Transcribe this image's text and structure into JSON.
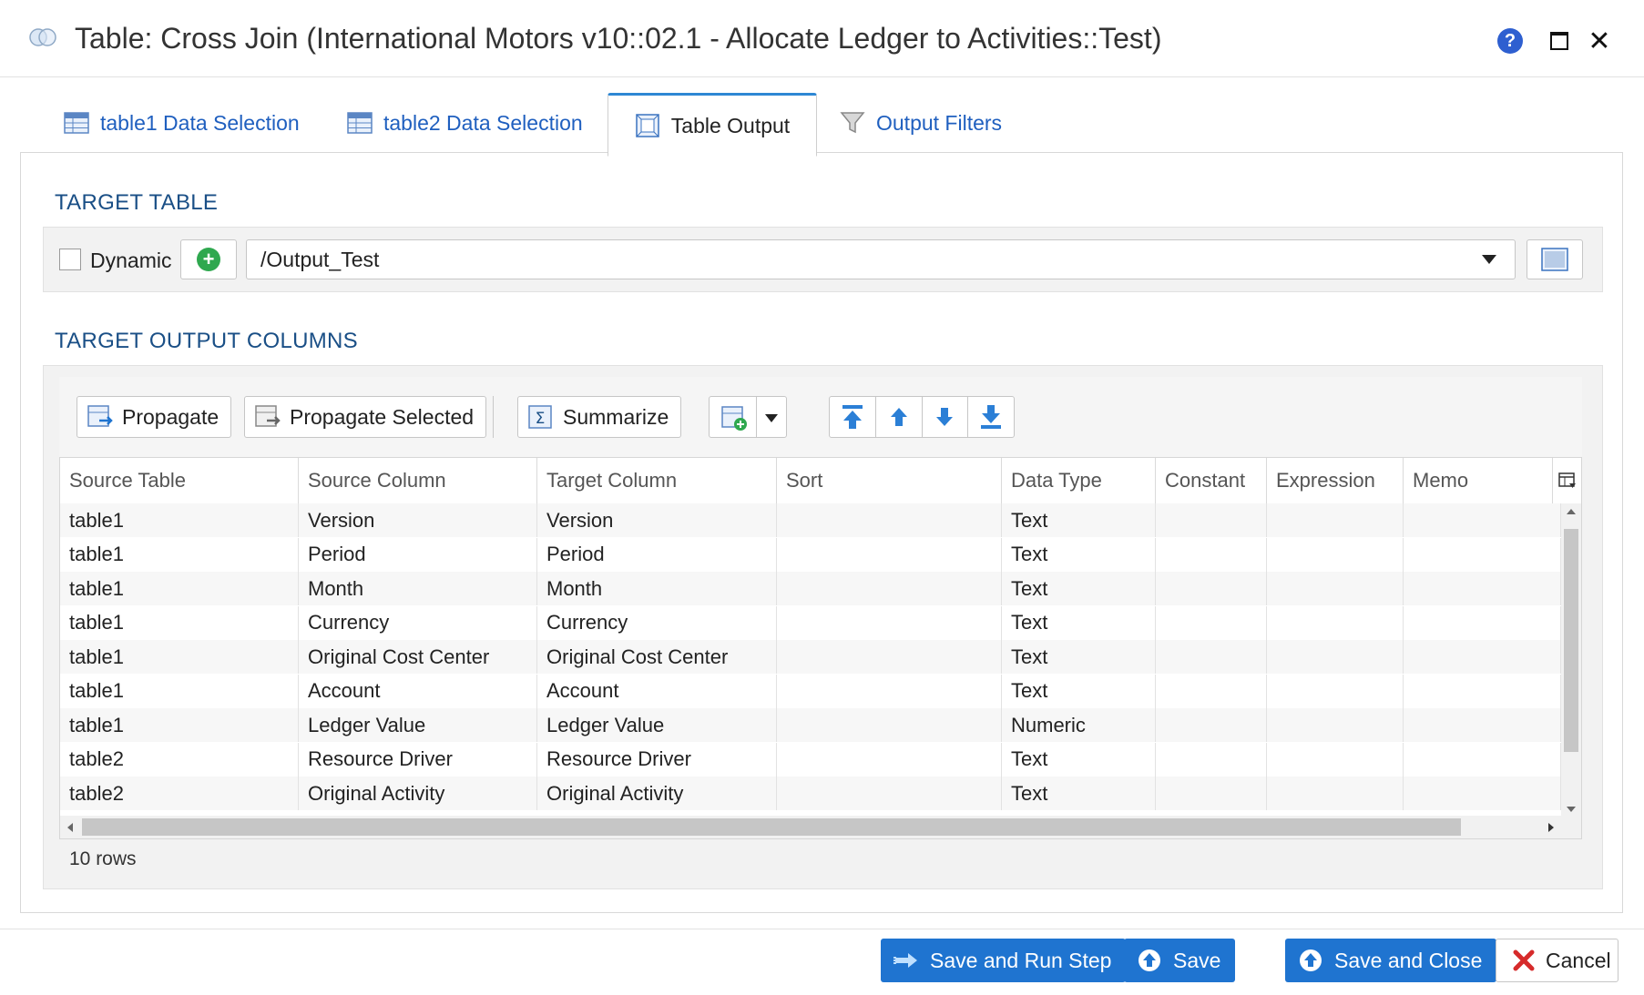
{
  "window": {
    "title": "Table: Cross Join (International Motors v10::02.1 - Allocate Ledger to Activities::Test)",
    "icons": {
      "app": "venn-icon",
      "help": "help-icon",
      "maximize": "maximize-icon",
      "close": "close-icon"
    },
    "help_glyph": "?",
    "close_glyph": "✕"
  },
  "tabs": [
    {
      "label": "table1 Data Selection",
      "icon": "table-icon",
      "active": false
    },
    {
      "label": "table2 Data Selection",
      "icon": "table-icon",
      "active": false
    },
    {
      "label": "Table Output",
      "icon": "table-output-icon",
      "active": true
    },
    {
      "label": "Output Filters",
      "icon": "filter-icon",
      "active": false
    }
  ],
  "target_table": {
    "section_title": "TARGET TABLE",
    "dynamic_label": "Dynamic",
    "dynamic_checked": false,
    "add_glyph": "+",
    "selected_table": "/Output_Test"
  },
  "output_columns": {
    "section_title": "TARGET OUTPUT COLUMNS",
    "toolbar": {
      "propagate": "Propagate",
      "propagate_selected": "Propagate Selected",
      "summarize": "Summarize"
    },
    "headers": [
      "Source Table",
      "Source Column",
      "Target Column",
      "Sort",
      "Data Type",
      "Constant",
      "Expression",
      "Memo"
    ],
    "rows": [
      [
        "table1",
        "Version",
        "Version",
        "",
        "Text",
        "",
        "",
        ""
      ],
      [
        "table1",
        "Period",
        "Period",
        "",
        "Text",
        "",
        "",
        ""
      ],
      [
        "table1",
        "Month",
        "Month",
        "",
        "Text",
        "",
        "",
        ""
      ],
      [
        "table1",
        "Currency",
        "Currency",
        "",
        "Text",
        "",
        "",
        ""
      ],
      [
        "table1",
        "Original Cost Center",
        "Original Cost Center",
        "",
        "Text",
        "",
        "",
        ""
      ],
      [
        "table1",
        "Account",
        "Account",
        "",
        "Text",
        "",
        "",
        ""
      ],
      [
        "table1",
        "Ledger Value",
        "Ledger Value",
        "",
        "Numeric",
        "",
        "",
        ""
      ],
      [
        "table2",
        "Resource Driver",
        "Resource Driver",
        "",
        "Text",
        "",
        "",
        ""
      ],
      [
        "table2",
        "Original Activity",
        "Original Activity",
        "",
        "Text",
        "",
        "",
        ""
      ]
    ],
    "row_count": "10 rows"
  },
  "footer": {
    "save_and_run": "Save and Run Step",
    "save": "Save",
    "save_and_close": "Save and Close",
    "cancel": "Cancel"
  },
  "colors": {
    "accent": "#1f74d0",
    "link": "#1f5fbf",
    "section_title": "#1a4f86",
    "add_green": "#2fa84f",
    "cancel_red": "#d62b2b"
  }
}
